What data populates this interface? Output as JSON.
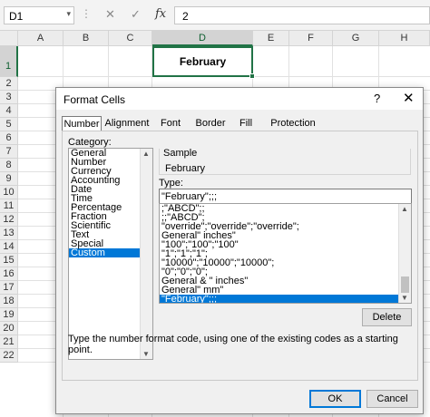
{
  "formula_bar": {
    "name_box": "D1",
    "name_box_dropdown": "▾",
    "separator": "⋮",
    "cancel_icon": "✕",
    "enter_icon": "✓",
    "fx_label": "fx",
    "content": "2"
  },
  "grid": {
    "columns": [
      "A",
      "B",
      "C",
      "D",
      "E",
      "F",
      "G",
      "H"
    ],
    "selected_column": "D",
    "rows": [
      "1",
      "2",
      "3",
      "4",
      "5",
      "6",
      "7",
      "8",
      "9",
      "10",
      "11",
      "12",
      "13",
      "14",
      "15",
      "16",
      "17",
      "18",
      "19",
      "20",
      "21",
      "22"
    ],
    "selected_row": "1",
    "active_cell_value": "February"
  },
  "dialog": {
    "title": "Format Cells",
    "help_icon": "?",
    "close_icon": "✕",
    "tabs": [
      "Number",
      "Alignment",
      "Font",
      "Border",
      "Fill",
      "Protection"
    ],
    "active_tab": "Number",
    "category_label": "Category:",
    "categories": [
      "General",
      "Number",
      "Currency",
      "Accounting",
      "Date",
      "Time",
      "Percentage",
      "Fraction",
      "Scientific",
      "Text",
      "Special",
      "Custom"
    ],
    "selected_category": "Custom",
    "sample_label": "Sample",
    "sample_value": "February",
    "type_label": "Type:",
    "type_value": "\"February\";;;",
    "formats": [
      ";\"ABCD\";;",
      ";;\"ABCD\";",
      "\"override\";\"override\";\"override\";",
      "General\" inches\"",
      "\"100\";\"100\";\"100\"",
      "\"1\";\"1\";\"1\";",
      "\"10000\";\"10000\";\"10000\";",
      "\"0\";\"0\";\"0\";",
      "General & \" inches\"",
      "General\" mm\"",
      "\"February\";;;"
    ],
    "selected_format": "\"February\";;;",
    "delete_button": "Delete",
    "description": "Type the number format code, using one of the existing codes as a starting point.",
    "ok_button": "OK",
    "cancel_button": "Cancel"
  }
}
